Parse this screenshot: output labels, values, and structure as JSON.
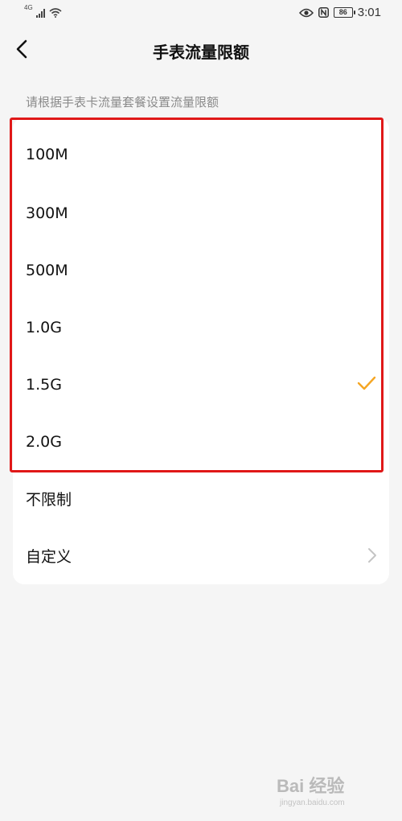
{
  "status_bar": {
    "network_type": "4G",
    "battery": "86",
    "time": "3:01"
  },
  "header": {
    "title": "手表流量限额"
  },
  "subtitle": "请根据手表卡流量套餐设置流量限额",
  "options": [
    {
      "label": "100M",
      "selected": false
    },
    {
      "label": "300M",
      "selected": false
    },
    {
      "label": "500M",
      "selected": false
    },
    {
      "label": "1.0G",
      "selected": false
    },
    {
      "label": "1.5G",
      "selected": true
    },
    {
      "label": "2.0G",
      "selected": false
    },
    {
      "label": "不限制",
      "selected": false
    },
    {
      "label": "自定义",
      "selected": false,
      "has_chevron": true
    }
  ],
  "colors": {
    "accent": "#f5a623",
    "highlight": "#e01818",
    "background": "#f5f5f5",
    "card": "#ffffff",
    "subtitle_text": "#8a8a8a"
  },
  "watermark": {
    "text": "Bai 经验",
    "url_text": "jingyan.baidu.com"
  }
}
